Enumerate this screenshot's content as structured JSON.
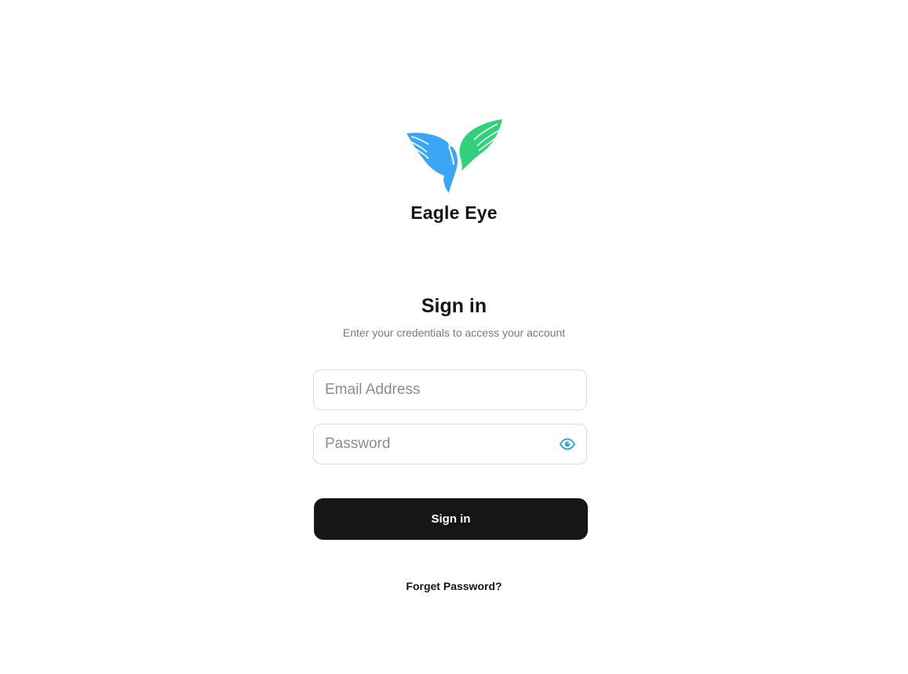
{
  "brand": {
    "name": "Eagle Eye",
    "logo_icon": "eagle-logo-icon",
    "colors": {
      "left_wing": "#3aa6f5",
      "right_wing": "#2fd27a"
    }
  },
  "form": {
    "title": "Sign in",
    "subtitle": "Enter your credentials to access your account",
    "email": {
      "placeholder": "Email Address",
      "value": ""
    },
    "password": {
      "placeholder": "Password",
      "value": "",
      "toggle_icon": "eye-icon",
      "toggle_color": "#2a9fe0"
    },
    "submit_label": "Sign in",
    "forgot_label": "Forget Password?"
  },
  "colors": {
    "button_bg": "#161616",
    "button_text": "#ffffff",
    "input_border": "#dcdcdc",
    "subtitle": "#7a7a7a"
  }
}
